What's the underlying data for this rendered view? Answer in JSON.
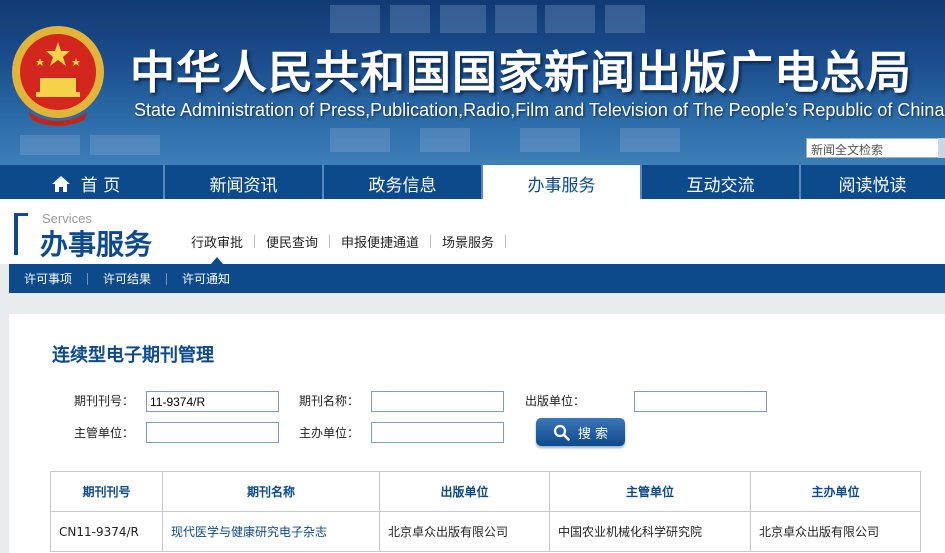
{
  "header": {
    "title": "中华人民共和国国家新闻出版广电总局",
    "subtitle": "State Administration of Press,Publication,Radio,Film and Television of The People’s Republic of China",
    "search_placeholder": "新闻全文检索"
  },
  "main_nav": [
    {
      "label": "首 页",
      "icon": "home-icon"
    },
    {
      "label": "新闻资讯"
    },
    {
      "label": "政务信息"
    },
    {
      "label": "办事服务",
      "active": true
    },
    {
      "label": "互动交流"
    },
    {
      "label": "阅读悦读"
    }
  ],
  "services": {
    "en_label": "Services",
    "zh_label": "办事服务",
    "subnav": [
      "行政审批",
      "便民查询",
      "申报便捷通道",
      "场景服务"
    ]
  },
  "subbar": [
    "许可事项",
    "许可结果",
    "许可通知"
  ],
  "page": {
    "title": "连续型电子期刊管理"
  },
  "form": {
    "journal_no_label": "期刊刊号：",
    "journal_no_value": "11-9374/R",
    "journal_name_label": "期刊名称：",
    "journal_name_value": "",
    "publisher_label": "出版单位：",
    "publisher_value": "",
    "supervisor_label": "主管单位：",
    "supervisor_value": "",
    "sponsor_label": "主办单位：",
    "sponsor_value": "",
    "search_button": "搜 索"
  },
  "table": {
    "columns": [
      "期刊刊号",
      "期刊名称",
      "出版单位",
      "主管单位",
      "主办单位"
    ],
    "rows": [
      [
        "CN11-9374/R",
        "现代医学与健康研究电子杂志",
        "北京卓众出版有限公司",
        "中国农业机械化科学研究院",
        "北京卓众出版有限公司"
      ]
    ]
  },
  "colors": {
    "brand_blue": "#0d4a8c",
    "banner_blue": "#1d4f8f"
  }
}
